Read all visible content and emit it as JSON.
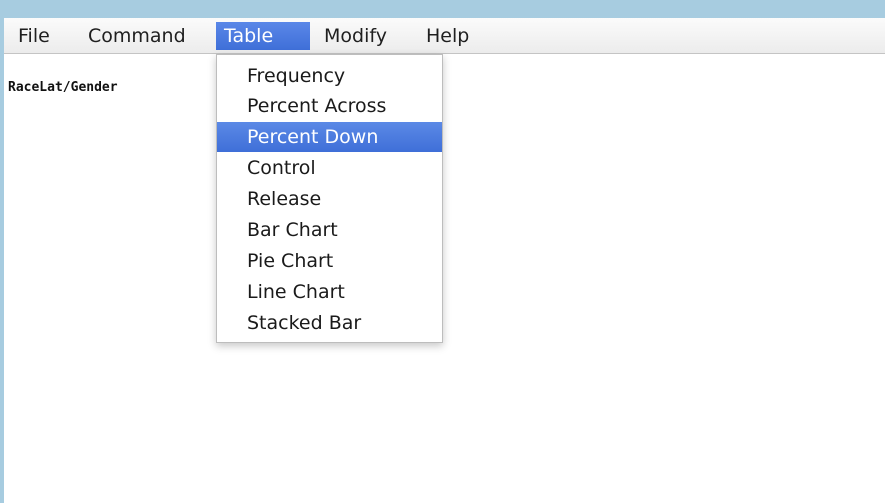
{
  "menubar": {
    "items": [
      {
        "label": "File"
      },
      {
        "label": "Command"
      },
      {
        "label": "Table",
        "active": true
      },
      {
        "label": "Modify"
      },
      {
        "label": "Help"
      }
    ]
  },
  "content": {
    "label": "RaceLat/Gender"
  },
  "table_menu": {
    "items": [
      {
        "label": "Frequency"
      },
      {
        "label": "Percent Across"
      },
      {
        "label": "Percent Down",
        "selected": true
      },
      {
        "label": "Control"
      },
      {
        "label": "Release"
      },
      {
        "label": "Bar Chart"
      },
      {
        "label": "Pie Chart"
      },
      {
        "label": "Line Chart"
      },
      {
        "label": "Stacked Bar"
      }
    ]
  },
  "colors": {
    "desktop": "#a7cce0",
    "highlight": "#4a7be0",
    "menubar": "#f5f5f5"
  }
}
